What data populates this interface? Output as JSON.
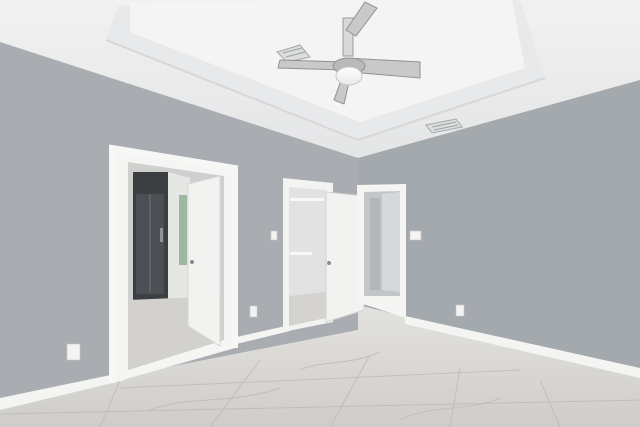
{
  "scene": {
    "subject": "empty-bedroom-interior",
    "colors": {
      "wall": "#a9adb2",
      "wall_right": "#a3a8ad",
      "ceiling": "#ecedee",
      "tray_ceiling": "#f3f3f3",
      "floor": "#d8d6d2",
      "trim": "#f4f4f3",
      "door": "#f2f2f1",
      "shower_glass": "#3c3f42"
    },
    "icons": [
      "ceiling-fan-icon",
      "air-vent-icon",
      "light-switch-icon",
      "outlet-icon",
      "door-handle-icon"
    ]
  }
}
